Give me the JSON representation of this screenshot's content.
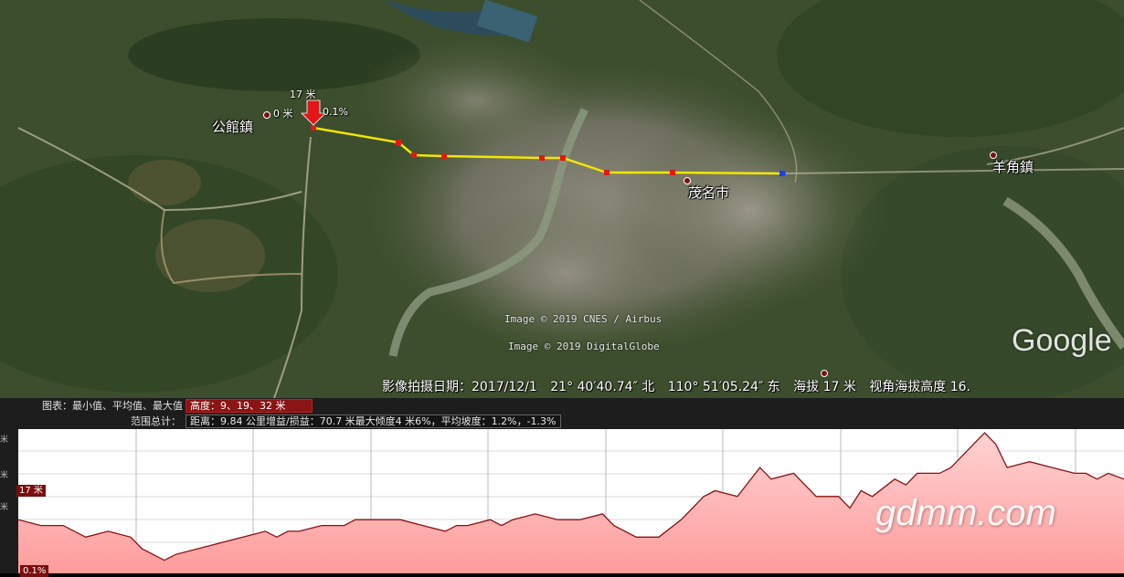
{
  "map": {
    "places": [
      {
        "name": "公館鎮"
      },
      {
        "name": "茂名市"
      },
      {
        "name": "羊角鎮"
      }
    ],
    "elevation_marker": {
      "value": "17 米"
    },
    "start_label": "0 米",
    "slope_label": "0.1%",
    "credits": [
      "Image © 2019 CNES / Airbus",
      "Image © 2019 DigitalGlobe"
    ],
    "logo": "Google",
    "colors": {
      "path": "#f2e600",
      "waypoint": "#e01818",
      "endpoint": "#1a3cff"
    }
  },
  "status_bar": {
    "imagery_date": "影像拍摄日期：2017/12/1",
    "latitude": "21° 40′40.74″ 北",
    "longitude": "110° 51′05.24″ 东",
    "elevation": "海拔    17 米",
    "eye_altitude": "视角海拔高度  16."
  },
  "profile": {
    "chart_label": "图表：最小值、平均值、最大值",
    "chart_stats": "高度：9、19、32 米",
    "range_label": "范围总计：",
    "range_stats": "距离：9.84 公里增益/损益：70.7 米最大倾度4 米6%，平均坡度：1.2%，-1.3%",
    "current_tag": "17 米",
    "bottom_tag": "0.1%",
    "left_ticks": [
      "米",
      "米",
      "米"
    ]
  },
  "chart_data": {
    "type": "area",
    "xlabel": "",
    "ylabel": "",
    "x_km": [
      0,
      0.2,
      0.4,
      0.6,
      0.8,
      1.0,
      1.1,
      1.3,
      1.4,
      1.6,
      1.8,
      2.0,
      2.2,
      2.3,
      2.4,
      2.5,
      2.7,
      2.9,
      3.0,
      3.2,
      3.4,
      3.6,
      3.8,
      3.9,
      4.0,
      4.2,
      4.3,
      4.4,
      4.6,
      4.8,
      5.0,
      5.2,
      5.3,
      5.5,
      5.7,
      5.9,
      6.0,
      6.1,
      6.2,
      6.4,
      6.6,
      6.7,
      6.9,
      7.0,
      7.1,
      7.3,
      7.4,
      7.5,
      7.6,
      7.8,
      7.9,
      8.0,
      8.2,
      8.3,
      8.4,
      8.6,
      8.7,
      8.8,
      9.0,
      9.2,
      9.4,
      9.5,
      9.6,
      9.7,
      9.84
    ],
    "elevation_m": [
      17,
      16,
      16,
      14,
      15,
      14,
      12,
      10,
      11,
      12,
      13,
      14,
      15,
      14,
      15,
      15,
      16,
      16,
      17,
      17,
      17,
      16,
      15,
      16,
      16,
      17,
      16,
      17,
      18,
      17,
      17,
      18,
      16,
      14,
      14,
      17,
      19,
      21,
      22,
      21,
      26,
      24,
      25,
      23,
      21,
      21,
      19,
      22,
      21,
      24,
      23,
      25,
      25,
      26,
      28,
      32,
      30,
      26,
      27,
      26,
      25,
      25,
      24,
      25,
      24
    ],
    "ylim": [
      9,
      32
    ],
    "grid": true
  },
  "watermark": "gdmm.com"
}
